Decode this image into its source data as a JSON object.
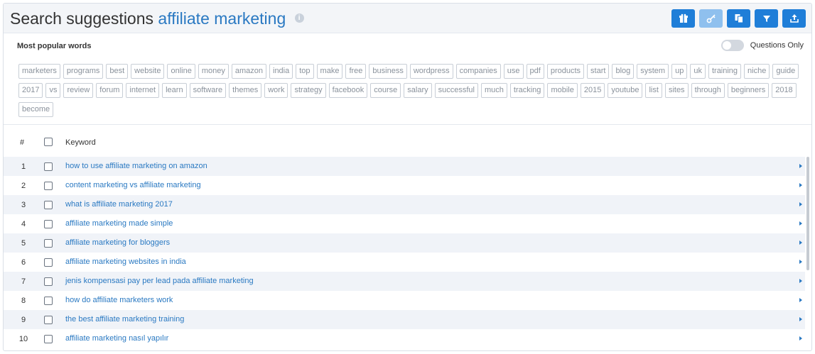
{
  "header": {
    "title_prefix": "Search suggestions",
    "title_keyword": "affiliate marketing",
    "info_icon": "info-icon",
    "toolbar": [
      {
        "name": "gift-button",
        "icon": "gift-icon",
        "disabled": false
      },
      {
        "name": "key-button",
        "icon": "key-icon",
        "disabled": true
      },
      {
        "name": "copy-button",
        "icon": "copy-icon",
        "disabled": false
      },
      {
        "name": "filter-button",
        "icon": "filter-icon",
        "disabled": false
      },
      {
        "name": "export-button",
        "icon": "upload-icon",
        "disabled": false
      }
    ]
  },
  "popular": {
    "label": "Most popular words",
    "toggle_label": "Questions Only",
    "toggle_on": false,
    "words": [
      "marketers",
      "programs",
      "best",
      "website",
      "online",
      "money",
      "amazon",
      "india",
      "top",
      "make",
      "free",
      "business",
      "wordpress",
      "companies",
      "use",
      "pdf",
      "products",
      "start",
      "blog",
      "system",
      "up",
      "uk",
      "training",
      "niche",
      "guide",
      "2017",
      "vs",
      "review",
      "forum",
      "internet",
      "learn",
      "software",
      "themes",
      "work",
      "strategy",
      "facebook",
      "course",
      "salary",
      "successful",
      "much",
      "tracking",
      "mobile",
      "2015",
      "youtube",
      "list",
      "sites",
      "through",
      "beginners",
      "2018",
      "become"
    ]
  },
  "table": {
    "col_num": "#",
    "col_keyword": "Keyword",
    "rows": [
      {
        "num": "1",
        "keyword": "how to use affiliate marketing on amazon"
      },
      {
        "num": "2",
        "keyword": "content marketing vs affiliate marketing"
      },
      {
        "num": "3",
        "keyword": "what is affiliate marketing 2017"
      },
      {
        "num": "4",
        "keyword": "affiliate marketing made simple"
      },
      {
        "num": "5",
        "keyword": "affiliate marketing for bloggers"
      },
      {
        "num": "6",
        "keyword": "affiliate marketing websites in india"
      },
      {
        "num": "7",
        "keyword": "jenis kompensasi pay per lead pada affiliate marketing"
      },
      {
        "num": "8",
        "keyword": "how do affiliate marketers work"
      },
      {
        "num": "9",
        "keyword": "the best affiliate marketing training"
      },
      {
        "num": "10",
        "keyword": "affiliate marketing nasıl yapılır"
      }
    ]
  },
  "colors": {
    "accent": "#1f7ed8",
    "accent_disabled": "#8fc0ee",
    "link": "#2a79c2",
    "row_alt": "#f0f3f8"
  }
}
